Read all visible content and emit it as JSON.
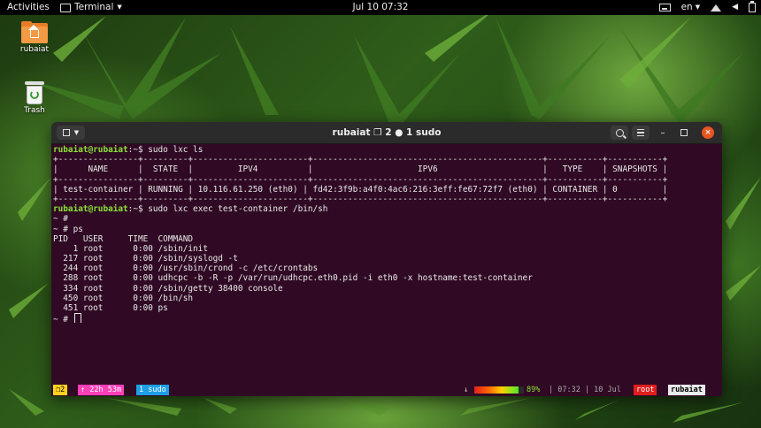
{
  "topbar": {
    "activities": "Activities",
    "app_name": "Terminal",
    "clock": "Jul 10  07:32",
    "language": "en"
  },
  "desktop": {
    "icons": [
      {
        "label": "rubaiat",
        "icon": "home-folder-icon"
      },
      {
        "label": "Trash",
        "icon": "trash-icon"
      }
    ]
  },
  "terminal": {
    "title": "rubaiat ❐ 2 ● 1 sudo",
    "lines": [
      {
        "prompt": "rubaiat@rubaiat",
        "text": ":~$ sudo lxc ls"
      },
      {
        "text": "+----------------+---------+-----------------------+----------------------------------------------+-----------+-----------+"
      },
      {
        "text": "|      NAME      |  STATE  |         IPV4          |                     IPV6                     |   TYPE    | SNAPSHOTS |"
      },
      {
        "text": "+----------------+---------+-----------------------+----------------------------------------------+-----------+-----------+"
      },
      {
        "text": "| test-container | RUNNING | 10.116.61.250 (eth0) | fd42:3f9b:a4f0:4ac6:216:3eff:fe67:72f7 (eth0) | CONTAINER | 0         |"
      },
      {
        "text": "+----------------+---------+-----------------------+----------------------------------------------+-----------+-----------+"
      },
      {
        "prompt": "rubaiat@rubaiat",
        "text": ":~$ sudo lxc exec test-container /bin/sh"
      },
      {
        "text": "~ #"
      },
      {
        "text": "~ # ps"
      },
      {
        "text": "PID   USER     TIME  COMMAND"
      },
      {
        "text": "    1 root      0:00 /sbin/init"
      },
      {
        "text": "  217 root      0:00 /sbin/syslogd -t"
      },
      {
        "text": "  244 root      0:00 /usr/sbin/crond -c /etc/crontabs"
      },
      {
        "text": "  288 root      0:00 udhcpc -b -R -p /var/run/udhcpc.eth0.pid -i eth0 -x hostname:test-container"
      },
      {
        "text": "  334 root      0:00 /sbin/getty 38400 console"
      },
      {
        "text": "  450 root      0:00 /bin/sh"
      },
      {
        "text": "  451 root      0:00 ps"
      },
      {
        "text": "~ # ",
        "cursor": true
      }
    ],
    "status": {
      "window": "❐2",
      "uptime": "↑ 22h 53m",
      "session": "1 sudo",
      "arrow": "↓",
      "battery_percent": 89,
      "battery_label": "89%",
      "time_date": "| 07:32 | 10 Jul",
      "user": "root",
      "host": "rubaiat",
      "colors": {
        "window": "#ffd21f",
        "uptime": "#ff3fb8",
        "session": "#1e9ee6",
        "user": "#e01e1e",
        "host": "#eaeaea"
      }
    }
  }
}
